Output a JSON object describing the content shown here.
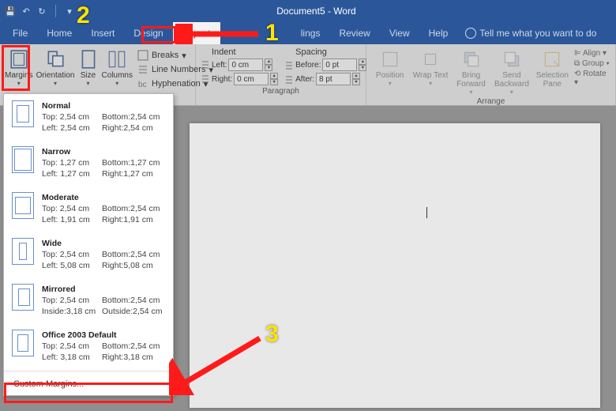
{
  "title": "Document5 - Word",
  "tabs": {
    "file": "File",
    "home": "Home",
    "insert": "Insert",
    "design": "Design",
    "layout": "Layout",
    "lings": "lings",
    "review": "Review",
    "view": "View",
    "help": "Help"
  },
  "tellme": "Tell me what you want to do",
  "ribbon": {
    "margins": "Margins",
    "orientation": "Orientation",
    "size": "Size",
    "columns": "Columns",
    "breaks": "Breaks",
    "line_numbers": "Line Numbers",
    "hyphenation": "Hyphenation",
    "indent": "Indent",
    "spacing": "Spacing",
    "left_lbl": "Left:",
    "right_lbl": "Right:",
    "before_lbl": "Before:",
    "after_lbl": "After:",
    "left_val": "0 cm",
    "right_val": "0 cm",
    "before_val": "0 pt",
    "after_val": "8 pt",
    "paragraph": "Paragraph",
    "position": "Position",
    "wrap_text": "Wrap Text",
    "bring_forward": "Bring Forward",
    "send_backward": "Send Backward",
    "selection_pane": "Selection Pane",
    "align": "Align",
    "group": "Group",
    "rotate": "Rotate",
    "arrange": "Arrange"
  },
  "presets": [
    {
      "name": "Normal",
      "tl": "Top:  2,54 cm",
      "bl": "Bottom:2,54 cm",
      "ll": "Left:  2,54 cm",
      "rl": "Right:2,54 cm"
    },
    {
      "name": "Narrow",
      "tl": "Top:  1,27 cm",
      "bl": "Bottom:1,27 cm",
      "ll": "Left:  1,27 cm",
      "rl": "Right:1,27 cm"
    },
    {
      "name": "Moderate",
      "tl": "Top:  2,54 cm",
      "bl": "Bottom:2,54 cm",
      "ll": "Left:  1,91 cm",
      "rl": "Right:1,91 cm"
    },
    {
      "name": "Wide",
      "tl": "Top:  2,54 cm",
      "bl": "Bottom:2,54 cm",
      "ll": "Left:  5,08 cm",
      "rl": "Right:5,08 cm"
    },
    {
      "name": "Mirrored",
      "tl": "Top:  2,54 cm",
      "bl": "Bottom:2,54 cm",
      "ll": "Inside:3,18 cm",
      "rl": "Outside:2,54 cm"
    },
    {
      "name": "Office 2003 Default",
      "tl": "Top:  2,54 cm",
      "bl": "Bottom:2,54 cm",
      "ll": "Left:  3,18 cm",
      "rl": "Right:3,18 cm"
    }
  ],
  "custom_margins": "Custom Margins...",
  "callouts": {
    "one": "1",
    "two": "2",
    "three": "3"
  }
}
